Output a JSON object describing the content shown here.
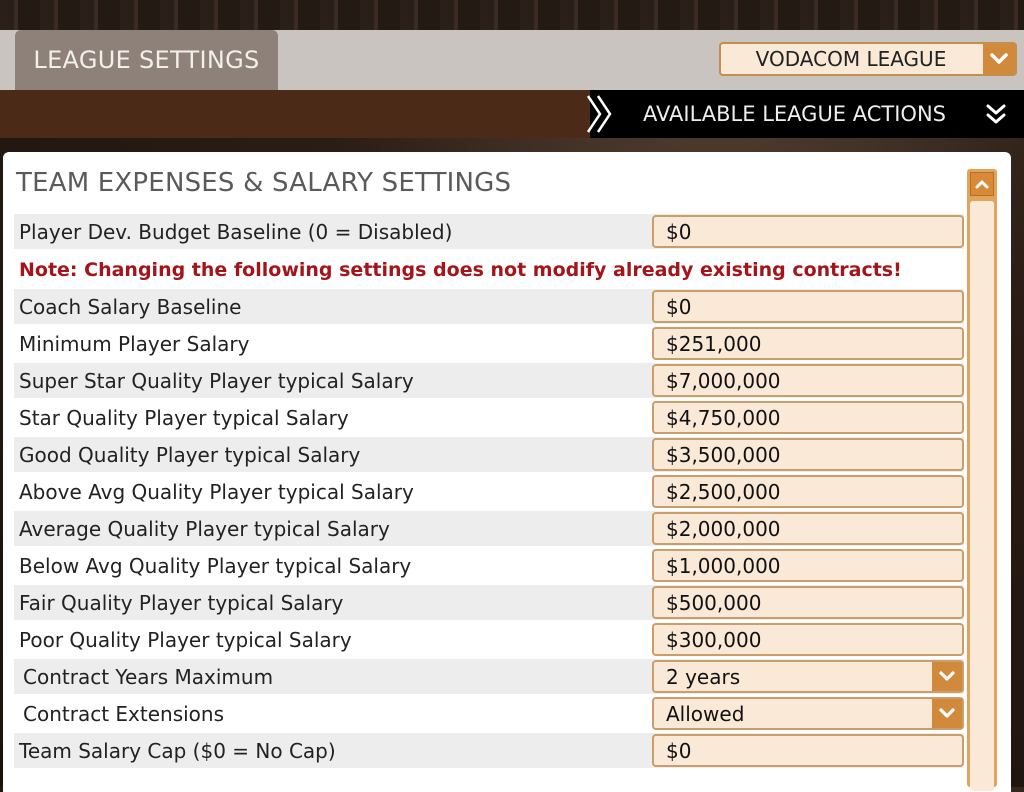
{
  "header": {
    "tab_label": "LEAGUE SETTINGS",
    "league_selected": "VODACOM LEAGUE",
    "actions_label": "AVAILABLE LEAGUE ACTIONS"
  },
  "section": {
    "title": "TEAM EXPENSES & SALARY SETTINGS",
    "note": "Note: Changing the following settings does not modify already existing contracts!"
  },
  "rows": [
    {
      "label": "Player Dev. Budget Baseline (0 = Disabled)",
      "value": "$0"
    },
    {
      "label": "Coach Salary Baseline",
      "value": "$0"
    },
    {
      "label": "Minimum Player Salary",
      "value": "$251,000"
    },
    {
      "label": "Super Star Quality Player typical Salary",
      "value": "$7,000,000"
    },
    {
      "label": "Star Quality Player typical Salary",
      "value": "$4,750,000"
    },
    {
      "label": "Good Quality Player typical Salary",
      "value": "$3,500,000"
    },
    {
      "label": "Above Avg Quality Player typical Salary",
      "value": "$2,500,000"
    },
    {
      "label": "Average Quality Player typical Salary",
      "value": "$2,000,000"
    },
    {
      "label": "Below Avg Quality Player typical Salary",
      "value": "$1,000,000"
    },
    {
      "label": "Fair Quality Player typical Salary",
      "value": "$500,000"
    },
    {
      "label": "Poor Quality Player typical Salary",
      "value": "$300,000"
    },
    {
      "label": "Contract Years Maximum",
      "value": "2 years"
    },
    {
      "label": "Contract Extensions",
      "value": "Allowed"
    },
    {
      "label": "Team Salary Cap ($0 = No Cap)",
      "value": "$0"
    }
  ],
  "colors": {
    "accent_orange": "#d18a3c",
    "field_bg": "#fbe9d7",
    "note_red": "#a3151a",
    "actions_brown": "#4b2b18"
  },
  "icons": {
    "league_dropdown": "chevron-down-icon",
    "actions_separator": "chevron-right-icon",
    "actions_expand": "double-chevron-down-icon",
    "scroll_up": "chevron-up-icon"
  }
}
